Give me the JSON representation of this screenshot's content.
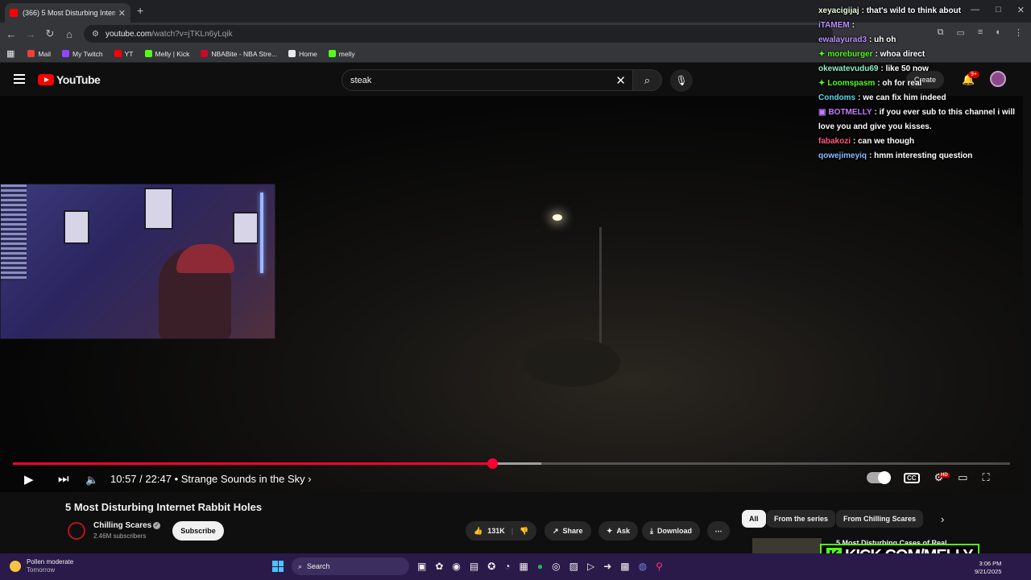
{
  "browser": {
    "tab_title": "(366) 5 Most Disturbing Interne",
    "tab_close": "✕",
    "new_tab": "+",
    "window_controls": [
      "—",
      "□",
      "✕"
    ],
    "url_host": "youtube.com",
    "url_path": "/watch?v=jTKLn6yLqik",
    "bookmarks": [
      {
        "label": "Mail",
        "color": "#ea4335"
      },
      {
        "label": "My Twitch",
        "color": "#9146ff"
      },
      {
        "label": "YT",
        "color": "#ff0000"
      },
      {
        "label": "Melly | Kick",
        "color": "#53fc18"
      },
      {
        "label": "NBABite - NBA Stre...",
        "color": "#c9082a"
      },
      {
        "label": "Home",
        "color": "#e8eaed"
      },
      {
        "label": "melly",
        "color": "#53fc18"
      }
    ]
  },
  "youtube": {
    "logo_text": "YouTube",
    "search_value": "steak",
    "create_label": "Create",
    "notif_badge": "9+"
  },
  "chat": [
    {
      "user": "xeyacigijaj",
      "color": "#e8ffe0",
      "text": ": that's wild to think about"
    },
    {
      "user": "iTAMEM",
      "color": "#b98cff",
      "text": ":"
    },
    {
      "user": "ewalayurad3",
      "color": "#b98cff",
      "text": ": uh oh"
    },
    {
      "user": "moreburger",
      "color": "#53fc18",
      "text": ": whoa direct",
      "badge": "✦"
    },
    {
      "user": "okewatevudu69",
      "color": "#8ef0c0",
      "text": ": like 50 now"
    },
    {
      "user": "Loomspasm",
      "color": "#53fc18",
      "text": ": oh for real",
      "badge": "✦"
    },
    {
      "user": "Condoms",
      "color": "#5ad8f0",
      "text": ": we can fix him indeed"
    },
    {
      "user": "BOTMELLY",
      "color": "#c07cff",
      "text": ": if you ever sub to this channel i will love you and give you kisses.",
      "badge": "▣"
    },
    {
      "user": "fabakozi",
      "color": "#ff5a7a",
      "text": ": can we though"
    },
    {
      "user": "qowejimeyiq",
      "color": "#8cb8ff",
      "text": ": hmm interesting question"
    }
  ],
  "player": {
    "current_time": "10:57",
    "duration": "22:47",
    "chapter": "• Strange Sounds in the Sky ›",
    "played_fraction": 0.4806,
    "buffered_fraction": 0.53
  },
  "video": {
    "title": "5 Most Disturbing Internet Rabbit Holes",
    "channel": "Chilling Scares",
    "subscribers": "2.46M subscribers",
    "subscribe_label": "Subscribe",
    "likes": "131K",
    "share_label": "Share",
    "ask_label": "Ask",
    "download_label": "Download",
    "more_label": "⋯"
  },
  "sidebar": {
    "chips": [
      "All",
      "From the series",
      "From Chilling Scares"
    ],
    "rec_title": "5 Most Disturbing Cases of Real"
  },
  "overlay": {
    "kick_letter": "K",
    "kick_text": "KICK.COM/MELLY"
  },
  "taskbar": {
    "weather_line1": "Pollen moderate",
    "weather_line2": "Tomorrow",
    "search_label": "Search",
    "time": "3:06 PM",
    "date": "9/21/2025"
  }
}
